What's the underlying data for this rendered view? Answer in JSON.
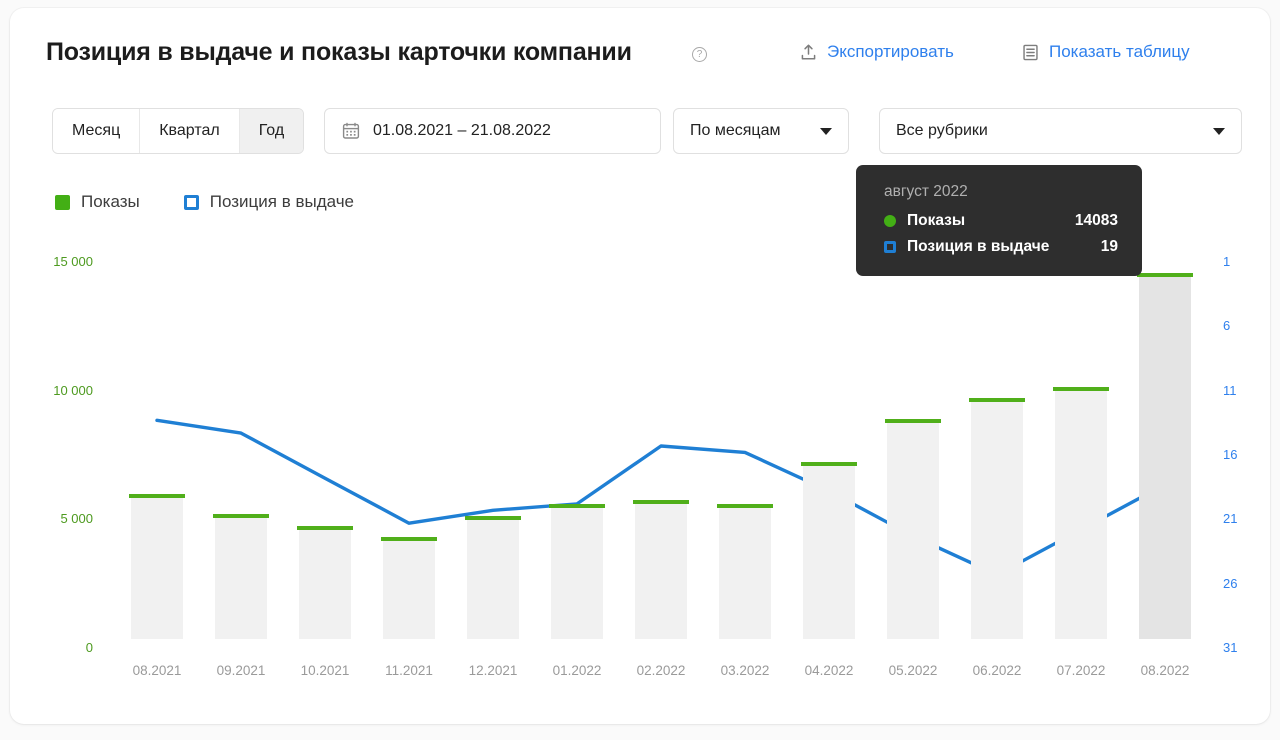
{
  "header": {
    "title": "Позиция в выдаче и показы карточки компании",
    "help_icon": "?",
    "export_label": "Экспортировать",
    "table_label": "Показать таблицу",
    "link_color": "#2f80ed"
  },
  "toolbar": {
    "segments": [
      {
        "label": "Месяц",
        "active": false
      },
      {
        "label": "Квартал",
        "active": false
      },
      {
        "label": "Год",
        "active": true
      }
    ],
    "date_range": "01.08.2021 – 21.08.2022",
    "period_select": "По месяцам",
    "rubric_select": "Все рубрики"
  },
  "legend": {
    "items": [
      {
        "label": "Показы",
        "type": "filled",
        "color": "#43af15"
      },
      {
        "label": "Позиция в выдаче",
        "type": "hollow",
        "color": "#1f7fd4"
      }
    ]
  },
  "tooltip": {
    "title": "август 2022",
    "rows": [
      {
        "marker": "dot",
        "name": "Показы",
        "value": "14083"
      },
      {
        "marker": "square",
        "name": "Позиция в выдаче",
        "value": "19"
      }
    ]
  },
  "chart_data": {
    "type": "bar",
    "title": "Позиция в выдаче и показы карточки компании",
    "xlabel": "",
    "categories": [
      "08.2021",
      "09.2021",
      "10.2021",
      "11.2021",
      "12.2021",
      "01.2022",
      "02.2022",
      "03.2022",
      "04.2022",
      "05.2022",
      "06.2022",
      "07.2022",
      "08.2022"
    ],
    "series": [
      {
        "name": "Показы",
        "type": "bar",
        "color": "#50af1a",
        "axis": "left",
        "values": [
          5480,
          4700,
          4250,
          3800,
          4640,
          5080,
          5250,
          5080,
          6740,
          8400,
          9200,
          9650,
          14083
        ]
      },
      {
        "name": "Позиция в выдаче",
        "type": "line",
        "color": "#1f7fd4",
        "axis": "right",
        "values": [
          14,
          15,
          18.5,
          22,
          21,
          20.5,
          16,
          16.5,
          19.5,
          23,
          26,
          22.5,
          19
        ]
      }
    ],
    "left_axis": {
      "label": "",
      "color": "#4d9a1f",
      "ticks": [
        "15 000",
        "10 000",
        "5 000",
        "0"
      ],
      "tick_values": [
        15000,
        10000,
        5000,
        0
      ],
      "ylim": [
        0,
        15000
      ]
    },
    "right_axis": {
      "label": "",
      "color": "#2f80ed",
      "ticks": [
        "1",
        "6",
        "11",
        "16",
        "21",
        "26",
        "31"
      ],
      "tick_values": [
        1,
        6,
        11,
        16,
        21,
        26,
        31
      ],
      "ylim": [
        31,
        1
      ],
      "inverted": true
    },
    "grid": false,
    "legend_position": "top-left",
    "highlighted_category": "08.2022"
  }
}
